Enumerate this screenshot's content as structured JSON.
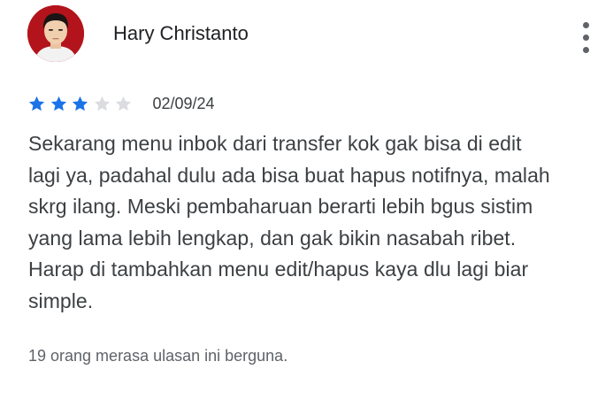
{
  "review": {
    "reviewer_name": "Hary Christanto",
    "avatar_icon": "user-photo-avatar",
    "rating": 3,
    "max_rating": 5,
    "star_filled_color": "#1a73e8",
    "star_empty_color": "#dadce0",
    "date": "02/09/24",
    "text": "Sekarang menu inbok dari transfer kok gak bisa di edit\nlagi ya, padahal dulu ada bisa buat hapus notifnya, malah\nskrg ilang. Meski pembaharuan berarti lebih bgus sistim\nyang lama lebih lengkap, dan gak bikin nasabah ribet.\nHarap di tambahkan menu edit/hapus kaya dlu lagi biar\nsimple.",
    "helpful_text": "19 orang merasa ulasan ini berguna.",
    "more_icon": "more-vert-icon"
  }
}
